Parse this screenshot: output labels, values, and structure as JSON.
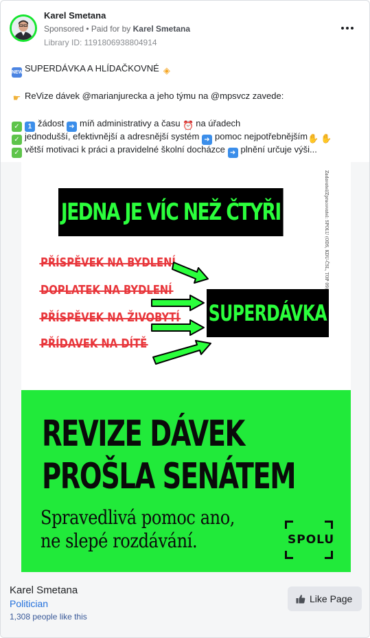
{
  "post": {
    "author": "Karel Smetana",
    "sponsored": "Sponsored",
    "paid_for_prefix": "• Paid for by",
    "paid_for_by": "Karel Smetana",
    "library_id": "Library ID: 1191806938804914",
    "lines": [
      "SUPERDÁVKA A HLÍDAČKOVNÉ",
      "ReVize dávek @marianjurecka a jeho týmu na @mpsvcz zavede:",
      "žádost",
      "míň administrativy a času",
      "na úřadech",
      "jednodušší, efektivnější a adresnější systém",
      "pomoc nejpotřebnějším",
      "větší motivaci k práci a pravidelné školní docházce",
      "plnění určuje výši..."
    ],
    "icons": {
      "new": "new-badge-icon",
      "point": "pointing-hand-icon",
      "check": "check-mark-icon",
      "one": "keycap-one-icon",
      "arrow": "right-arrow-icon",
      "clock": "alarm-clock-icon",
      "hands": "handshake-icon",
      "diamond": "warning-diamond-icon"
    }
  },
  "ad": {
    "headline_box": "JEDNA JE VÍC NEŽ ČTYŘI",
    "struck_items": [
      "PŘÍSPĚVEK NA BYDLENÍ",
      "DOPLATEK NA BYDLENÍ",
      "PŘÍSPĚVEK NA ŽIVOBYTÍ",
      "PŘÍDAVEK NA DÍTĚ"
    ],
    "result_box": "SUPERDÁVKA",
    "vertical_text": "Zadavatel/Zpracovatel: SPOLU (ODS, KDU-ČSL, TOP 09)",
    "big_line1": "REVIZE DÁVEK",
    "big_line2": "PROŠLA SENÁTEM",
    "sub_line1": "Spravedlivá pomoc ano,",
    "sub_line2": "ne slepé rozdávání.",
    "logo": "SPOLU",
    "colors": {
      "green": "#21ea3a",
      "black": "#000000",
      "red": "#e8363b",
      "neon_text": "#2bff3c"
    }
  },
  "footer": {
    "page_name": "Karel Smetana",
    "category": "Politician",
    "likes": "1,308 people like this",
    "like_button": "Like Page"
  }
}
